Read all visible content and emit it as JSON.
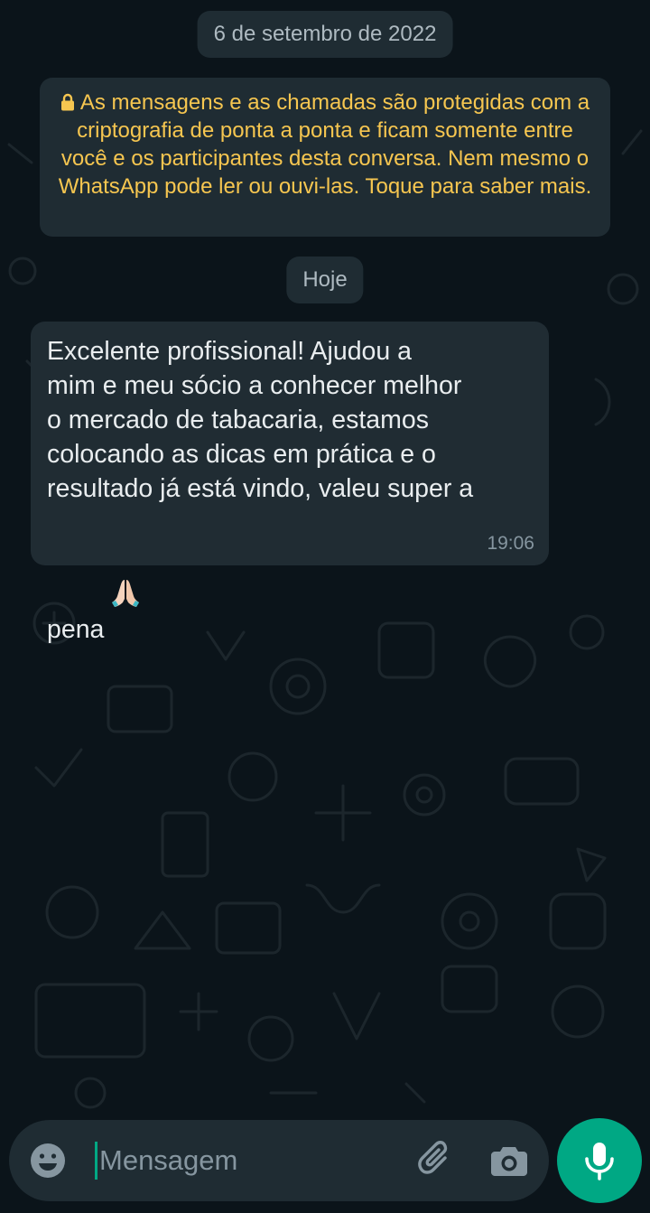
{
  "chat": {
    "date_separator": "6 de setembro de 2022",
    "encryption_notice": "As mensagens e as chamadas são protegidas com a criptografia de ponta a ponta e ficam somente entre você e os participantes desta conversa. Nem mesmo o WhatsApp pode ler ou ouvi-las. Toque para saber mais.",
    "today_separator": "Hoje",
    "messages": [
      {
        "direction": "incoming",
        "text": "Excelente profissional! Ajudou a\nmim e meu sócio a conhecer melhor\no mercado de tabacaria, estamos\ncolocando as dicas em prática e o\nresultado já está vindo, valeu super a\npena",
        "emoji": "folded-hands",
        "time": "19:06"
      }
    ]
  },
  "composer": {
    "placeholder": "Mensagem",
    "value": ""
  },
  "icons": {
    "lock": "lock-icon",
    "emoji": "emoji-smiley-icon",
    "attach": "paperclip-icon",
    "camera": "camera-icon",
    "mic": "microphone-icon"
  },
  "colors": {
    "background": "#0b141a",
    "bubble": "#202c33",
    "notice_text": "#f6c650",
    "accent": "#00a884"
  }
}
